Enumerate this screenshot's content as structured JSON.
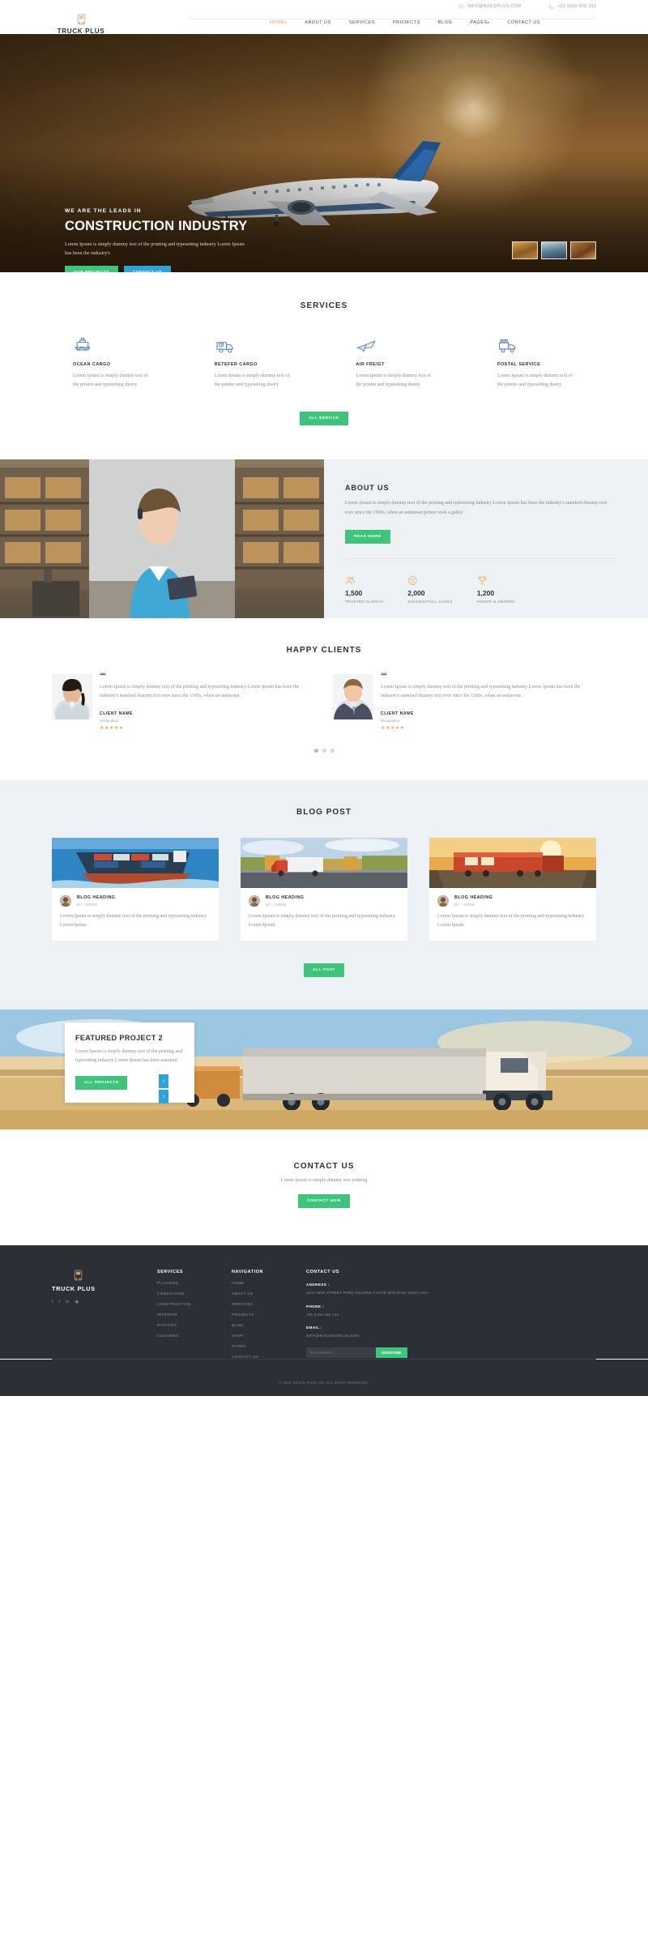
{
  "topbar": {
    "email": "INFO@BUILDPLUS.COM",
    "phone": "+91 5565 665 333",
    "email_icon": "envelope-icon",
    "phone_icon": "phone-icon"
  },
  "brand": {
    "name": "TRUCK PLUS",
    "logo_icon": "truck-logo-icon"
  },
  "nav": {
    "items": [
      {
        "label": "HOME",
        "caret": "▾",
        "active": true
      },
      {
        "label": "ABOUT US",
        "caret": "",
        "active": false
      },
      {
        "label": "SERVICES",
        "caret": "",
        "active": false
      },
      {
        "label": "PROJECTS",
        "caret": "",
        "active": false
      },
      {
        "label": "BLOG",
        "caret": "",
        "active": false
      },
      {
        "label": "PAGES",
        "caret": "▾",
        "active": false
      },
      {
        "label": "CONTACT US",
        "caret": "",
        "active": false
      }
    ]
  },
  "hero": {
    "kicker": "WE ARE THE LEADS IN",
    "title": "CONSTRUCTION INDUSTRY",
    "description": "Lorem Ipsum is simply dummy text of the printing and typesetting industry Lorem Ipsum has been the industry's",
    "btn_primary": "OUR PROJECTS",
    "btn_secondary": "CONTACT US",
    "thumbs": [
      "slide-thumb-1",
      "slide-thumb-2",
      "slide-thumb-3"
    ]
  },
  "services": {
    "title": "SERVICES",
    "items": [
      {
        "icon": "ship-icon",
        "name": "OCEAN CARGO",
        "text": "Lorem Ipsum is simply dummy text of the printin and typesetting dustry"
      },
      {
        "icon": "truck-icon",
        "name": "RETEFER CARGO",
        "text": "Lorem Ipsum is simply dummy text of the printin and typesetting dustry"
      },
      {
        "icon": "plane-icon",
        "name": "AIR FREIGT",
        "text": "Lorem Ipsum is simply dummy text of the printin and typesetting dustry"
      },
      {
        "icon": "mail-truck-icon",
        "name": "POSTAL SERVICE",
        "text": "Lorem Ipsum is simply dummy text of the printin and typesetting dustry"
      }
    ],
    "cta": "ALL SERVICE"
  },
  "about": {
    "title": "ABOUT US",
    "text": "Lorem Ipsum is simply dummy text of the printing and typesetting industry Lorem Ipsum has been the industry's standard dummy text ever since the 1500s, when an unknown printer took a galley",
    "cta": "READ MORE",
    "photo": "warehouse-worker-photo",
    "counters": [
      {
        "icon": "users-icon",
        "value": "1,500",
        "label": "TRUSTED CLIENTS"
      },
      {
        "icon": "smiley-icon",
        "value": "2,000",
        "label": "SUCCESSFULL CASES"
      },
      {
        "icon": "trophy-icon",
        "value": "1,200",
        "label": "HONOR & AWARDS"
      }
    ]
  },
  "clients": {
    "title": "HAPPY CLIENTS",
    "items": [
      {
        "photo": "client-photo-1",
        "quote_mark": "““",
        "text": "Lorem Ipsum is simply dummy text of the printing and typesetting industry Lorem Ipsum has been the industry's standard dummy text ever since the 1500s, when an unknown.",
        "name": "CLIENT NAME",
        "designation": "Designation",
        "stars": "★★★★★"
      },
      {
        "photo": "client-photo-2",
        "quote_mark": "““",
        "text": "Lorem Ipsum is simply dummy text of the printing and typesetting industry Lorem Ipsum has been the industry's standard dummy text ever since the 1500s, when an unknown.",
        "name": "CLIENT NAME",
        "designation": "Designation",
        "stars": "★★★★★"
      }
    ],
    "dots": [
      "dot-1",
      "dot-2",
      "dot-3"
    ]
  },
  "blog": {
    "title": "BLOG POST",
    "posts": [
      {
        "image": "container-ship-photo",
        "heading": "BLOG HEADING",
        "by": "BY : ADMIN",
        "text": "Lorem Ipsum is simply dummy text of the printing and typesetting industry Lorem Ipsum."
      },
      {
        "image": "red-truck-photo",
        "heading": "BLOG HEADING",
        "by": "BY : ADMIN",
        "text": "Lorem Ipsum is simply dummy text of the printing and typesetting industry Lorem Ipsum."
      },
      {
        "image": "freight-train-photo",
        "heading": "BLOG HEADING",
        "by": "BY : ADMIN",
        "text": "Lorem Ipsum is simply dummy text of the printing and typesetting industry Lorem Ipsum."
      }
    ],
    "cta": "ALL POST"
  },
  "featured": {
    "title": "FEATURED PROJECT 2",
    "text": "Lorem Ipsum is simply dummy text of the printing and typesetting industry Lorem Ipsum has been standard",
    "cta": "ALL PROJECTS",
    "prev": "‹",
    "next": "›",
    "background": "truck-desert-photo"
  },
  "contact": {
    "title": "CONTACT US",
    "subtitle": "Lorem Ipsum is simply dummy text printing",
    "cta": "CONTACT NOW"
  },
  "footer": {
    "brand": {
      "name": "TRUCK PLUS",
      "logo_icon": "truck-logo-icon"
    },
    "social": [
      "facebook-icon",
      "twitter-icon",
      "linkedin-icon",
      "instagram-icon"
    ],
    "services": {
      "heading": "SERVICES",
      "items": [
        "PLANNING",
        "CONSULTING",
        "CONSTRUCTION",
        "INTERIOR",
        "PAINTING",
        "CLEANING"
      ]
    },
    "navigation": {
      "heading": "NAVIGATION",
      "items": [
        "HOME",
        "ABOUT US",
        "SERVICES",
        "PROJECTS",
        "BLOG",
        "SHOP",
        "PAGES",
        "CONTACT US"
      ]
    },
    "contact": {
      "heading": "CONTACT US",
      "address_label": "ADDRESS :",
      "address_value": "1234 NEW STREET PARQ SECOND FLOOR BUILDING 29402 USA",
      "phone_label": "PHONE :",
      "phone_value": "+91 5465 456 123",
      "email_label": "EMAIL :",
      "email_value": "INFO@BUILDINGPLUS.COM",
      "newsletter_placeholder": "Email Address",
      "newsletter_button": "SUBSCRIBE"
    },
    "copyright": "© 2018 TRUCK PLUS LTD. ALL RIGHT RESERVED."
  },
  "colors": {
    "green": "#3fc47c",
    "blue": "#2fa3d8",
    "orange": "#e8a33d",
    "dark": "#2b2f36",
    "gold": "#e4b055"
  }
}
